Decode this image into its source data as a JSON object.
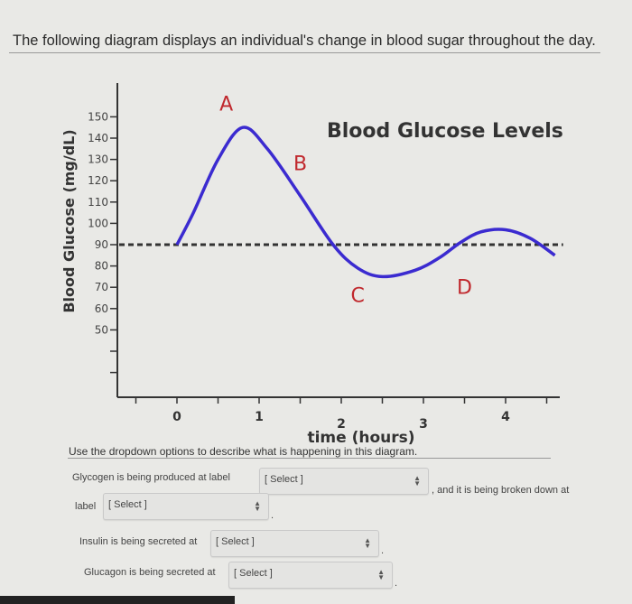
{
  "prompt": "The following diagram displays an individual's change in blood sugar throughout the day.",
  "chart_data": {
    "type": "line",
    "title": "Blood Glucose Levels",
    "xlabel": "time (hours)",
    "ylabel": "Blood Glucose (mg/dL)",
    "x_ticks": [
      "0",
      "1",
      "2",
      "3",
      "4"
    ],
    "y_ticks": [
      "50",
      "60",
      "70",
      "80",
      "90",
      "100",
      "110",
      "120",
      "130",
      "140",
      "150"
    ],
    "xlim": [
      -0.7,
      4.7
    ],
    "ylim": [
      20,
      155
    ],
    "reference_line": {
      "y": 90,
      "style": "dashed"
    },
    "series": [
      {
        "color": "#3b2bd0",
        "x": [
          0,
          0.2,
          0.5,
          0.8,
          1.1,
          1.5,
          1.9,
          2.2,
          2.5,
          2.9,
          3.2,
          3.45,
          3.7,
          4.0,
          4.3,
          4.6
        ],
        "y": [
          90,
          105,
          130,
          145,
          135,
          113,
          90,
          79,
          75,
          78,
          84,
          91,
          96,
          97,
          93,
          85
        ]
      }
    ],
    "annotations": [
      {
        "text": "A",
        "x": 0.6,
        "y": 153,
        "color": "#c0282d"
      },
      {
        "text": "B",
        "x": 1.5,
        "y": 125,
        "color": "#c0282d"
      },
      {
        "text": "C",
        "x": 2.2,
        "y": 63,
        "color": "#c0282d"
      },
      {
        "text": "D",
        "x": 3.5,
        "y": 67,
        "color": "#c0282d"
      }
    ]
  },
  "instructions": "Use the dropdown options to describe what is happening in this diagram.",
  "q1": {
    "before": "Glycogen is being produced at label",
    "after": ", and it is being broken down at",
    "value": "[ Select ]"
  },
  "q2": {
    "before": "label",
    "value": "[ Select ]",
    "after": "."
  },
  "q3": {
    "before": "Insulin is being secreted at",
    "value": "[ Select ]",
    "after": "."
  },
  "q4": {
    "before": "Glucagon is being secreted at",
    "value": "[ Select ]",
    "after": "."
  }
}
